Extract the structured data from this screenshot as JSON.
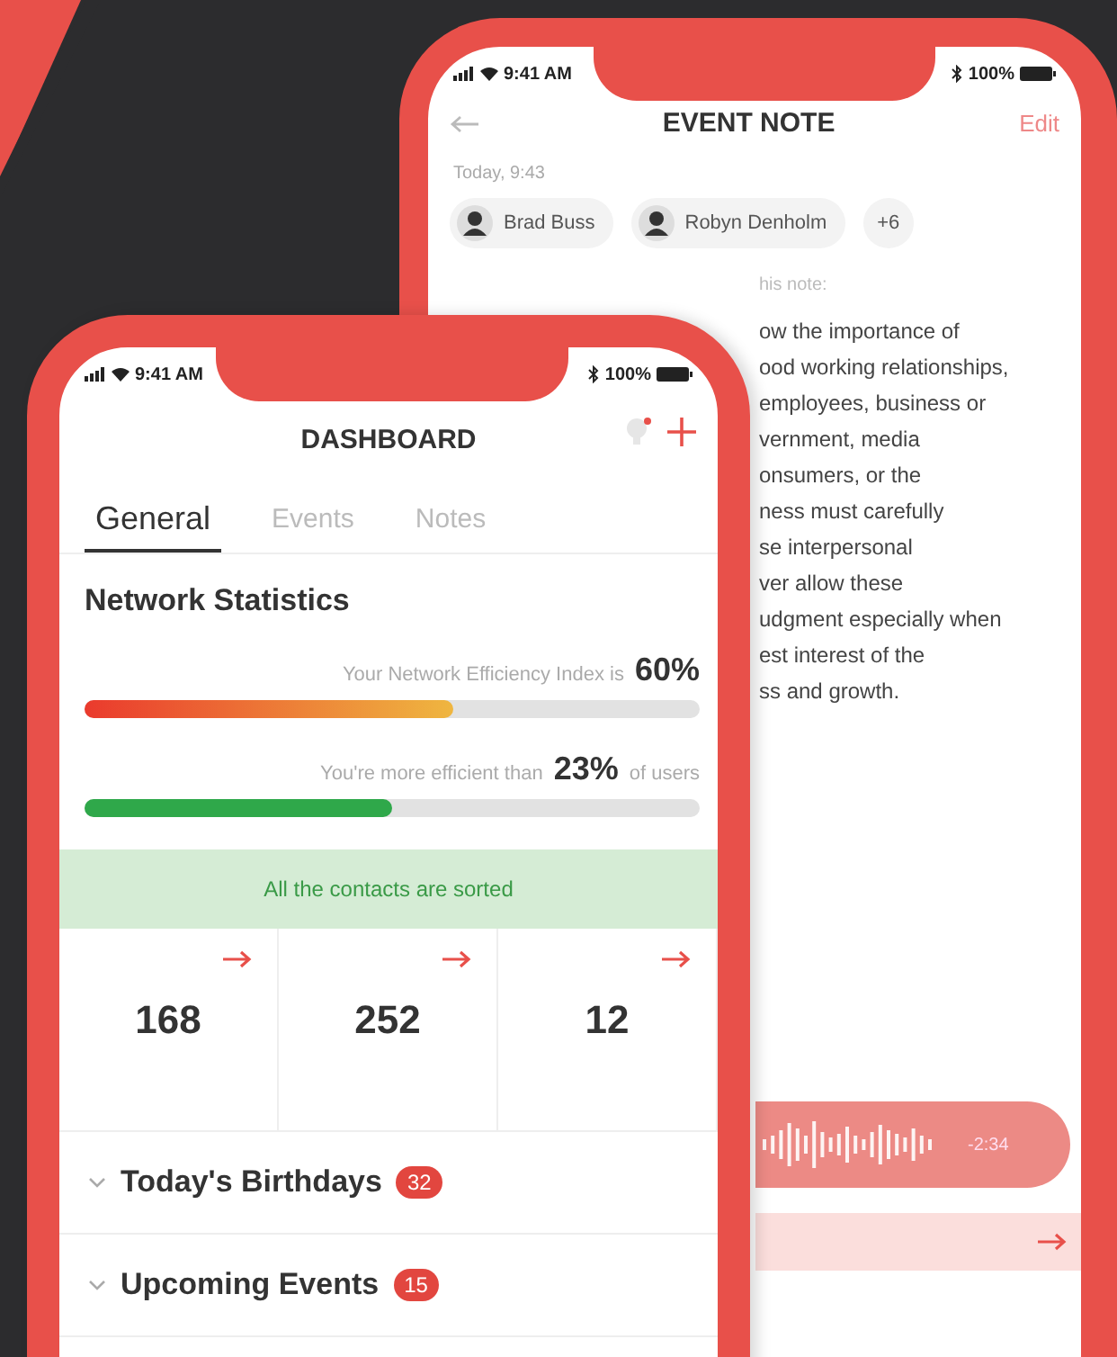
{
  "event_note": {
    "status": {
      "time": "9:41 AM",
      "battery": "100%"
    },
    "title": "EVENT NOTE",
    "action": "Edit",
    "date": "Today, 9:43",
    "participants": [
      {
        "name": "Brad Buss"
      },
      {
        "name": "Robyn Denholm"
      }
    ],
    "more": "+6",
    "note_label": "his note:",
    "note_lines": [
      "ow the importance of",
      "ood working relationships,",
      "employees, business or",
      "vernment, media",
      "onsumers, or the",
      "ness must carefully",
      "se interpersonal",
      "ver allow these",
      "udgment especially when",
      "est interest of the",
      "ss and growth."
    ],
    "audio": {
      "time": "-2:34"
    }
  },
  "dashboard": {
    "status": {
      "time": "9:41 AM",
      "battery": "100%"
    },
    "title": "DASHBOARD",
    "tabs": [
      {
        "label": "General",
        "selected": true
      },
      {
        "label": "Events",
        "selected": false
      },
      {
        "label": "Notes",
        "selected": false
      }
    ],
    "section": "Network Statistics",
    "metrics": [
      {
        "kind": "index",
        "label": "Your Network Efficiency Index is",
        "value": "60%",
        "level": 0.6
      },
      {
        "kind": "comparison",
        "label": "You're more efficient than",
        "value": "23%",
        "suffix": "of users",
        "level": 0.5
      }
    ],
    "banner": "All the contacts are sorted",
    "stats": [
      "168",
      "252",
      "12"
    ],
    "lists": [
      {
        "title": "Today's Birthdays",
        "count": "32"
      },
      {
        "title": "Upcoming Events",
        "count": "15"
      }
    ]
  }
}
